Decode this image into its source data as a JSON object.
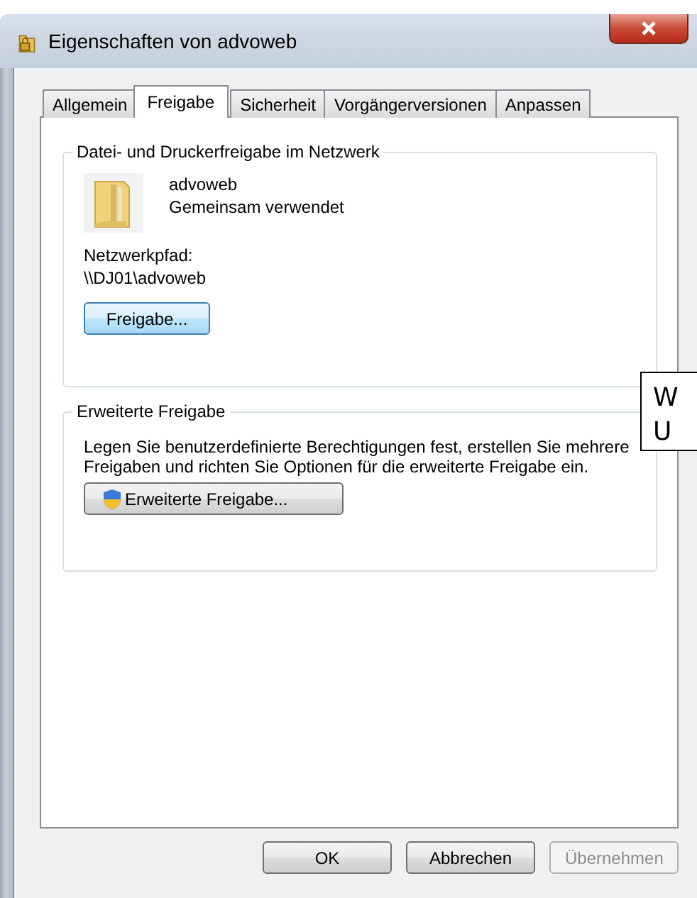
{
  "window": {
    "title": "Eigenschaften von advoweb"
  },
  "tabs": [
    {
      "label": "Allgemein",
      "selected": false
    },
    {
      "label": "Freigabe",
      "selected": true
    },
    {
      "label": "Sicherheit",
      "selected": false
    },
    {
      "label": "Vorgängerversionen",
      "selected": false
    },
    {
      "label": "Anpassen",
      "selected": false
    }
  ],
  "sharing_group": {
    "title": "Datei- und Druckerfreigabe im Netzwerk",
    "item_name": "advoweb",
    "item_status": "Gemeinsam verwendet",
    "path_label": "Netzwerkpfad:",
    "path": "\\\\DJ01\\advoweb",
    "button": {
      "label": "Freigabe...",
      "focused": true
    }
  },
  "advanced_group": {
    "title": "Erweiterte Freigabe",
    "description": "Legen Sie benutzerdefinierte Berechtigungen fest, erstellen Sie mehrere Freigaben und richten Sie Optionen für die erweiterte Freigabe ein.",
    "button": "Erweiterte Freigabe..."
  },
  "buttons": [
    {
      "label": "OK",
      "disabled": false
    },
    {
      "label": "Abbrechen",
      "disabled": false
    },
    {
      "label": "Übernehmen",
      "disabled": true
    }
  ],
  "callout": {
    "lines": [
      "W",
      "U"
    ]
  }
}
